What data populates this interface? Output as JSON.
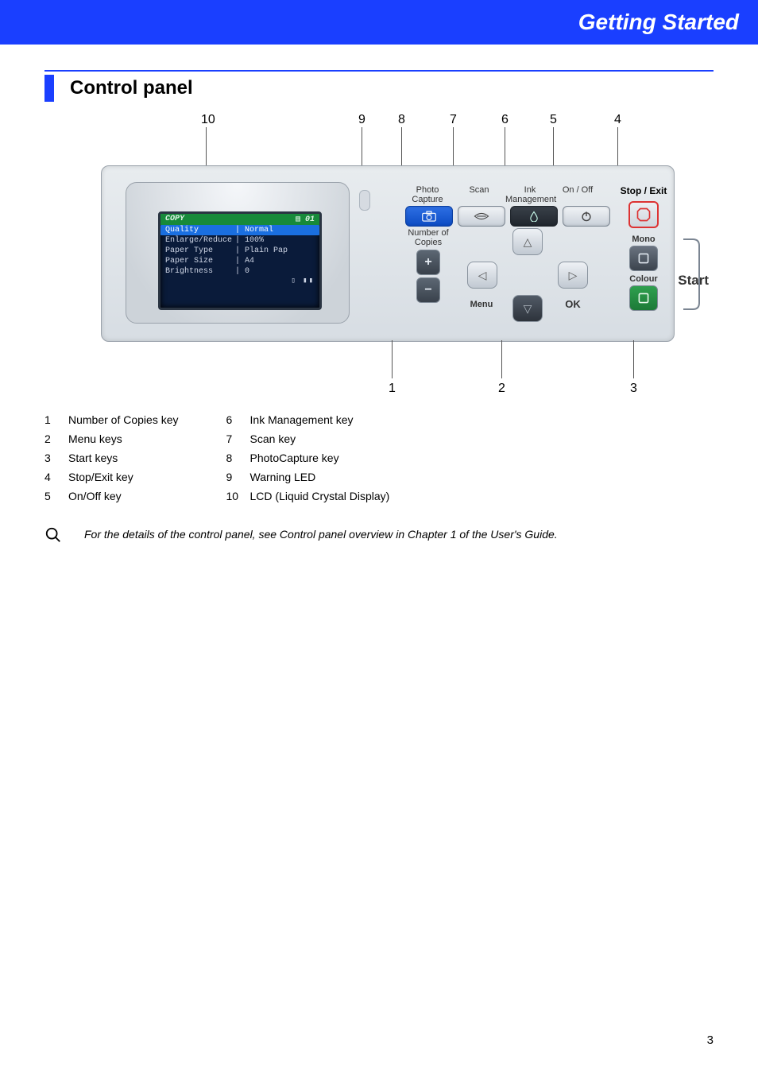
{
  "header": {
    "title": "Getting Started"
  },
  "section": {
    "title": "Control panel"
  },
  "callouts": {
    "top": {
      "n10": "10",
      "n9": "9",
      "n8": "8",
      "n7": "7",
      "n6": "6",
      "n5": "5",
      "n4": "4"
    },
    "bottom": {
      "n1": "1",
      "n2": "2",
      "n3": "3"
    }
  },
  "panel": {
    "photo_capture": "Photo\nCapture",
    "scan": "Scan",
    "ink_mgmt": "Ink\nManagement",
    "on_off": "On / Off",
    "number_of_copies": "Number of\nCopies",
    "menu": "Menu",
    "ok": "OK",
    "stop_exit": "Stop / Exit",
    "mono": "Mono",
    "colour": "Colour",
    "start": "Start"
  },
  "lcd": {
    "title": "COPY",
    "page": "01",
    "rows": [
      {
        "k": "Quality",
        "v": "Normal",
        "sel": true
      },
      {
        "k": "Enlarge/Reduce",
        "v": "100%"
      },
      {
        "k": "Paper Type",
        "v": "Plain Pap"
      },
      {
        "k": "Paper Size",
        "v": "A4"
      },
      {
        "k": "Brightness",
        "v": "0"
      }
    ]
  },
  "legend": {
    "left": [
      {
        "n": "1",
        "t": "Number of Copies key"
      },
      {
        "n": "2",
        "t": "Menu keys"
      },
      {
        "n": "3",
        "t": "Start keys"
      },
      {
        "n": "4",
        "t": "Stop/Exit key"
      },
      {
        "n": "5",
        "t": "On/Off key"
      }
    ],
    "right": [
      {
        "n": "6",
        "t": "Ink Management key"
      },
      {
        "n": "7",
        "t": "Scan key"
      },
      {
        "n": "8",
        "t": "PhotoCapture key"
      },
      {
        "n": "9",
        "t": "Warning LED"
      },
      {
        "n": "10",
        "t": "LCD (Liquid Crystal Display)"
      }
    ]
  },
  "note": "For the details of the control panel, see Control panel overview in Chapter 1 of the User's Guide.",
  "page_number": "3"
}
